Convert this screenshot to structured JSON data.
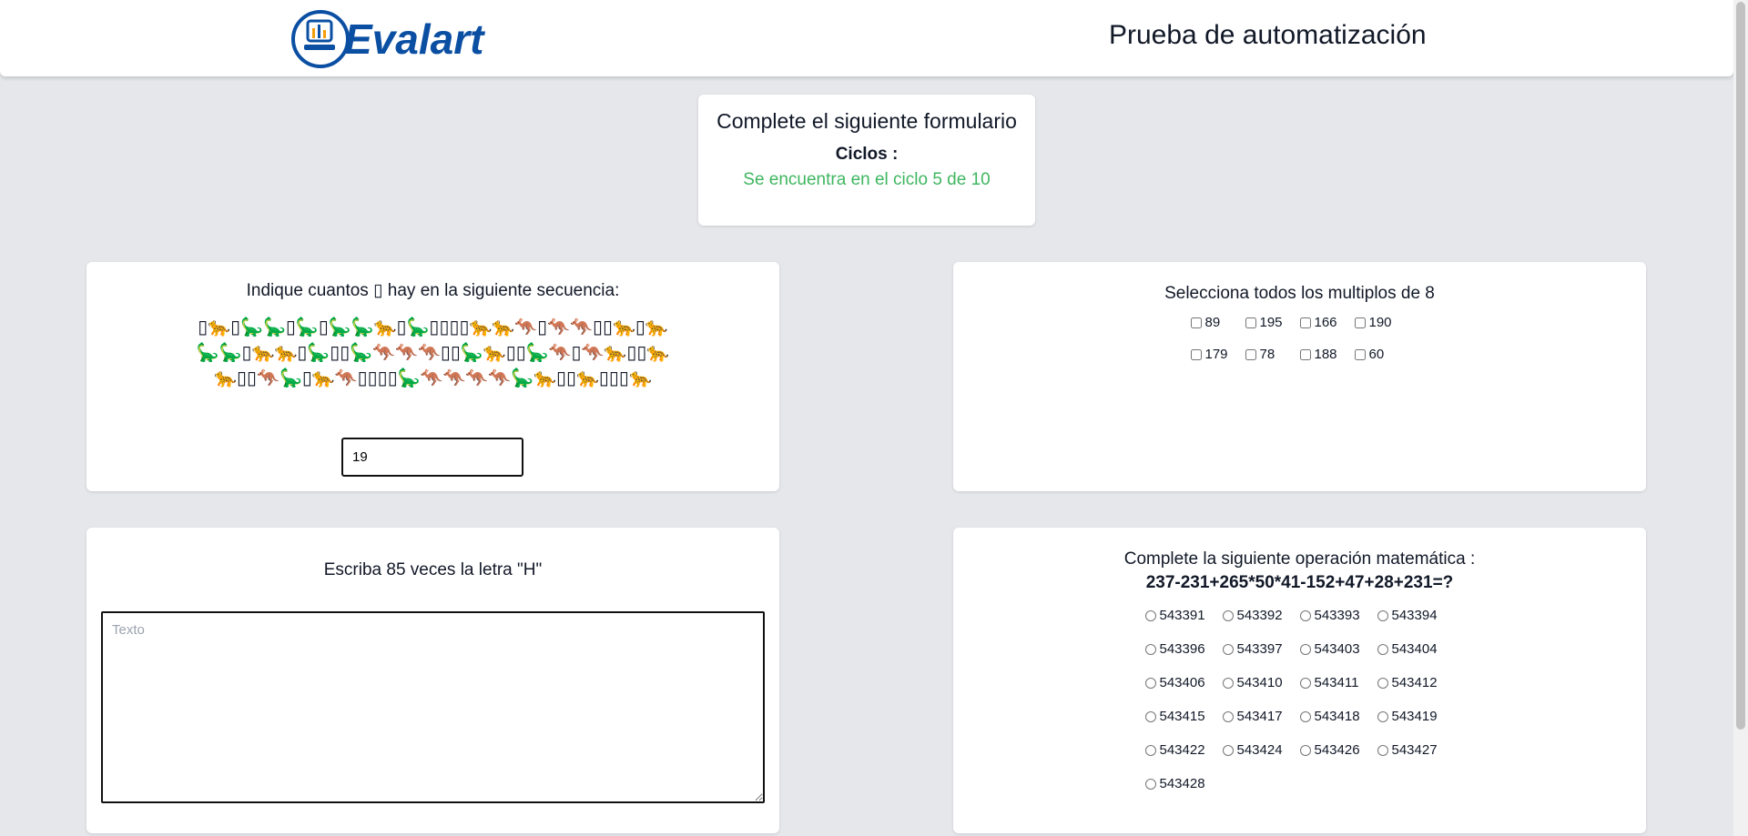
{
  "header": {
    "logo_text": "Evalart",
    "title": "Prueba de automatización"
  },
  "summary": {
    "title": "Complete el siguiente formulario",
    "ciclos_label": "Ciclos :",
    "ciclo_status": "Se encuentra en el ciclo 5 de 10"
  },
  "sequence_question": {
    "prompt": "Indique cuantos ▯ hay en la siguiente secuencia:",
    "sequence": "▯🐆▯🦕🦕▯🦕▯🦕🦕🐆▯🦕▯▯▯▯🐆🐆🦘▯🦘🦘▯▯🐆▯🐆🦕🦕▯🐆🐆▯🦕▯▯🦕🦘🦘🦘▯▯🦕🐆▯▯🦕🦘▯🦘🐆▯▯🐆🐆▯▯🦘🦕▯🐆🦘▯▯▯▯🦕🦘🦘🦘🦘🦕🐆▯▯🐆▯▯▯🐆",
    "answer_value": "19"
  },
  "multiples_question": {
    "prompt": "Selecciona todos los multiplos de 8",
    "options": [
      "89",
      "195",
      "166",
      "190",
      "179",
      "78",
      "188",
      "60"
    ]
  },
  "text_question": {
    "prompt": "Escriba 85 veces la letra \"H\"",
    "placeholder": "Texto"
  },
  "math_question": {
    "prompt": "Complete la siguiente operación matemática :",
    "expression": "237-231+265*50*41-152+47+28+231=?",
    "options": [
      "543391",
      "543392",
      "543393",
      "543394",
      "543396",
      "543397",
      "543403",
      "543404",
      "543406",
      "543410",
      "543411",
      "543412",
      "543415",
      "543417",
      "543418",
      "543419",
      "543422",
      "543424",
      "543426",
      "543427",
      "543428"
    ]
  }
}
